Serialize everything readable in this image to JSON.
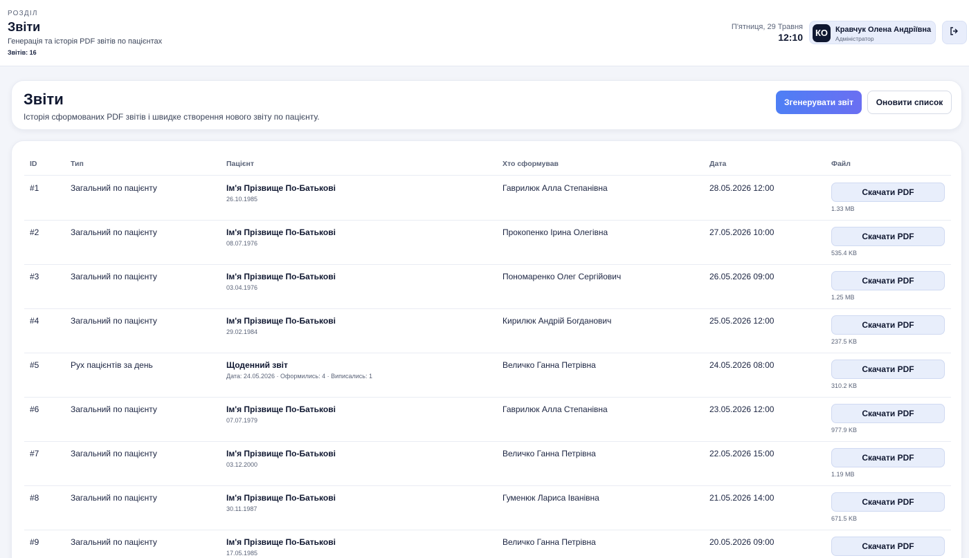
{
  "topbar": {
    "section_label": "Розділ",
    "title": "Звіти",
    "subtitle": "Генерація та історія PDF звітів по пацієнтах",
    "count": "Звітів: 16",
    "date": "П'ятниця, 29 Травня",
    "time": "12:10",
    "user": {
      "initials": "КО",
      "name": "Кравчук Олена Андріївна",
      "role": "Адміністратор"
    },
    "logout_icon": "logout-icon"
  },
  "header": {
    "title": "Звіти",
    "subtitle": "Історія сформованих PDF звітів і швидке створення нового звіту по пацієнту.",
    "generate_label": "Згенерувати звіт",
    "refresh_label": "Оновити список"
  },
  "table": {
    "columns": {
      "id": "ID",
      "type": "Тип",
      "patient": "Пацієнт",
      "author": "Хто сформував",
      "date": "Дата",
      "file": "Файл"
    },
    "rows": [
      {
        "id": "#1",
        "type": "Загальний по пацієнту",
        "patient": "Ім'я Прізвище По-Батькові",
        "patient_sub": "26.10.1985",
        "author": "Гаврилюк Алла Степанівна",
        "date": "28.05.2026 12:00",
        "download": "Скачати PDF",
        "size": "1.33 MB"
      },
      {
        "id": "#2",
        "type": "Загальний по пацієнту",
        "patient": "Ім'я Прізвище По-Батькові",
        "patient_sub": "08.07.1976",
        "author": "Прокопенко Ірина Олегівна",
        "date": "27.05.2026 10:00",
        "download": "Скачати PDF",
        "size": "535.4 KB"
      },
      {
        "id": "#3",
        "type": "Загальний по пацієнту",
        "patient": "Ім'я Прізвище По-Батькові",
        "patient_sub": "03.04.1976",
        "author": "Пономаренко Олег Сергійович",
        "date": "26.05.2026 09:00",
        "download": "Скачати PDF",
        "size": "1.25 MB"
      },
      {
        "id": "#4",
        "type": "Загальний по пацієнту",
        "patient": "Ім'я Прізвище По-Батькові",
        "patient_sub": "29.02.1984",
        "author": "Кирилюк Андрій Богданович",
        "date": "25.05.2026 12:00",
        "download": "Скачати PDF",
        "size": "237.5 KB"
      },
      {
        "id": "#5",
        "type": "Рух пацієнтів за день",
        "patient": "Щоденний звіт",
        "patient_sub": "Дата: 24.05.2026 · Оформились: 4 · Виписались: 1",
        "author": "Величко Ганна Петрівна",
        "date": "24.05.2026 08:00",
        "download": "Скачати PDF",
        "size": "310.2 KB"
      },
      {
        "id": "#6",
        "type": "Загальний по пацієнту",
        "patient": "Ім'я Прізвище По-Батькові",
        "patient_sub": "07.07.1979",
        "author": "Гаврилюк Алла Степанівна",
        "date": "23.05.2026 12:00",
        "download": "Скачати PDF",
        "size": "977.9 KB"
      },
      {
        "id": "#7",
        "type": "Загальний по пацієнту",
        "patient": "Ім'я Прізвище По-Батькові",
        "patient_sub": "03.12.2000",
        "author": "Величко Ганна Петрівна",
        "date": "22.05.2026 15:00",
        "download": "Скачати PDF",
        "size": "1.19 MB"
      },
      {
        "id": "#8",
        "type": "Загальний по пацієнту",
        "patient": "Ім'я Прізвище По-Батькові",
        "patient_sub": "30.11.1987",
        "author": "Гуменюк Лариса Іванівна",
        "date": "21.05.2026 14:00",
        "download": "Скачати PDF",
        "size": "671.5 KB"
      },
      {
        "id": "#9",
        "type": "Загальний по пацієнту",
        "patient": "Ім'я Прізвище По-Батькові",
        "patient_sub": "17.05.1985",
        "author": "Величко Ганна Петрівна",
        "date": "20.05.2026 09:00",
        "download": "Скачати PDF",
        "size": ""
      }
    ]
  },
  "colors": {
    "accent_start": "#4e7ff5",
    "accent_end": "#6a6ff2",
    "text_primary": "#0f1730",
    "background": "#f3f5fa"
  }
}
